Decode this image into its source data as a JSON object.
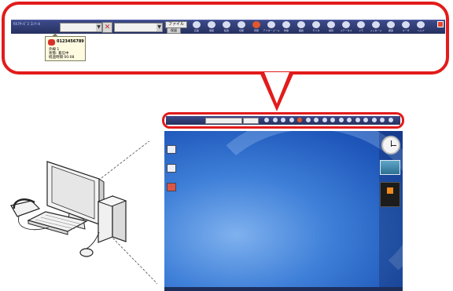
{
  "toolbar": {
    "app_title": "ｾﾙﾌｻｰﾋﾞｽ ｺﾝｿｰﾙ",
    "combo1_value": "",
    "combo2_value": "",
    "file_button": "ファイル",
    "secondary_button": "保留",
    "icons": [
      {
        "name": "answer-icon",
        "label": "応答"
      },
      {
        "name": "hold-icon",
        "label": "保留"
      },
      {
        "name": "transfer-icon",
        "label": "転送"
      },
      {
        "name": "hangup-icon",
        "label": "切断"
      },
      {
        "name": "ready-icon",
        "label": "待受",
        "red": true
      },
      {
        "name": "after-call-icon",
        "label": "アフターコール"
      },
      {
        "name": "break-icon",
        "label": "休憩"
      },
      {
        "name": "consult-icon",
        "label": "相談"
      },
      {
        "name": "monitor-icon",
        "label": "モニタ"
      },
      {
        "name": "record-icon",
        "label": "録音"
      },
      {
        "name": "status-icon",
        "label": "ステータス"
      },
      {
        "name": "memo-icon",
        "label": "メモ"
      },
      {
        "name": "message-icon",
        "label": "メッセージ"
      },
      {
        "name": "history-icon",
        "label": "履歴"
      },
      {
        "name": "user-icon",
        "label": "ユーザ"
      },
      {
        "name": "help-icon",
        "label": "ヘルプ"
      }
    ]
  },
  "popup": {
    "number": "0123456789",
    "line1": "外線 1",
    "line2": "状態: 着信中",
    "line3": "経過時間 00:08"
  },
  "colors": {
    "callout_red": "#e21b1b",
    "toolbar_blue": "#2c376b",
    "desktop_blue": "#3e7fd8"
  }
}
